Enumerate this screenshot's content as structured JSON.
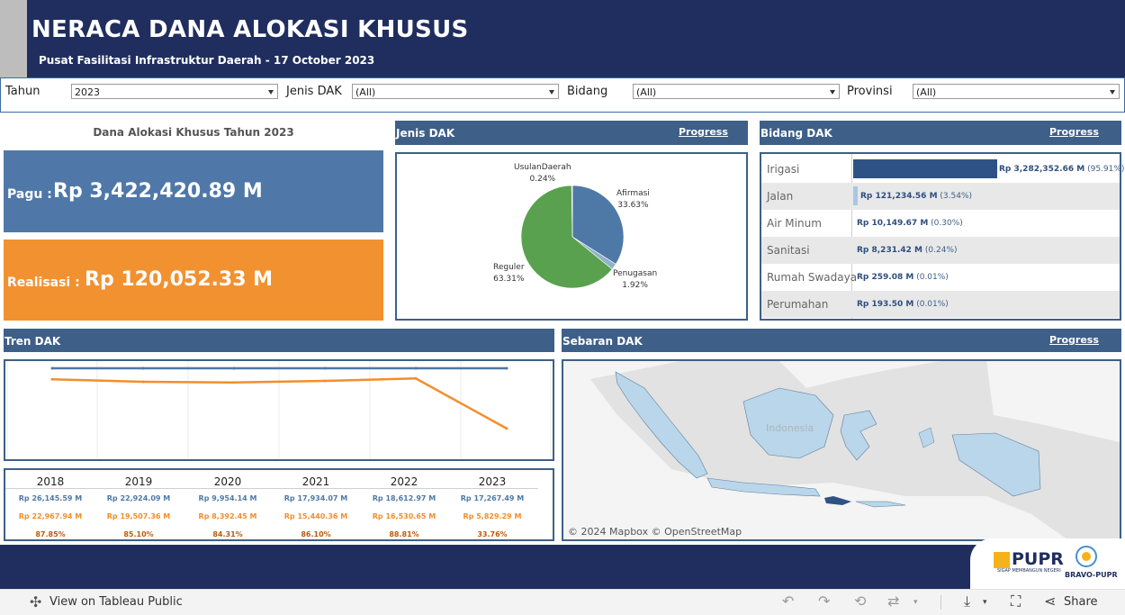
{
  "header": {
    "title": "NERACA DANA ALOKASI KHUSUS",
    "subtitle": "Pusat Fasilitasi Infrastruktur Daerah - 17 October 2023"
  },
  "filters": [
    {
      "label": "Tahun",
      "value": "2023"
    },
    {
      "label": "Jenis DAK",
      "value": "(All)"
    },
    {
      "label": "Bidang",
      "value": "(All)"
    },
    {
      "label": "Provinsi",
      "value": "(All)"
    }
  ],
  "summary": {
    "title": "Dana Alokasi Khusus Tahun 2023",
    "pagu_label": "Pagu :",
    "pagu_value": "Rp 3,422,420.89 M",
    "realisasi_label": "Realisasi :",
    "realisasi_value": "Rp 120,052.33 M",
    "pagu_color": "#4f78a8",
    "realisasi_color": "#f29130"
  },
  "jenis_dak": {
    "title": "Jenis DAK",
    "link": "Progress",
    "slices": [
      {
        "name": "Afirmasi",
        "pct": "33.63%",
        "value": 33.63,
        "color": "#4e79a7"
      },
      {
        "name": "Penugasan",
        "pct": "1.92%",
        "value": 1.92,
        "color": "#8fb4c6"
      },
      {
        "name": "Reguler",
        "pct": "63.31%",
        "value": 63.31,
        "color": "#59a14f"
      },
      {
        "name": "UsulanDaerah",
        "pct": "0.24%",
        "value": 0.24,
        "color": "#e1c04a"
      }
    ]
  },
  "bidang_dak": {
    "title": "Bidang DAK",
    "link": "Progress",
    "rows": [
      {
        "name": "Irigasi",
        "amount": "Rp 3,282,352.66 M",
        "pct": "(95.91%)",
        "value": 95.91
      },
      {
        "name": "Jalan",
        "amount": "Rp 121,234.56 M",
        "pct": "(3.54%)",
        "value": 3.54
      },
      {
        "name": "Air Minum",
        "amount": "Rp 10,149.67 M",
        "pct": "(0.30%)",
        "value": 0.3
      },
      {
        "name": "Sanitasi",
        "amount": "Rp 8,231.42 M",
        "pct": "(0.24%)",
        "value": 0.24
      },
      {
        "name": "Rumah Swadaya",
        "amount": "Rp 259.08 M",
        "pct": "(0.01%)",
        "value": 0.01
      },
      {
        "name": "Perumahan",
        "amount": "Rp 193.50 M",
        "pct": "(0.01%)",
        "value": 0.01
      }
    ]
  },
  "tren_dak": {
    "title": "Tren DAK",
    "years": [
      "2018",
      "2019",
      "2020",
      "2021",
      "2022",
      "2023"
    ],
    "pagu": [
      "Rp 26,145.59 M",
      "Rp 22,924.09 M",
      "Rp 9,954.14 M",
      "Rp 17,934.07 M",
      "Rp 18,612.97 M",
      "Rp 17,267.49 M"
    ],
    "realisasi": [
      "Rp 22,967.94 M",
      "Rp 19,507.36 M",
      "Rp 8,392.45 M",
      "Rp 15,440.36 M",
      "Rp 16,530.65 M",
      "Rp 5,829.29 M"
    ],
    "persen": [
      "87.85%",
      "85.10%",
      "84.31%",
      "86.10%",
      "88.81%",
      "33.76%"
    ]
  },
  "chart_data": {
    "type": "line",
    "x": [
      "2018",
      "2019",
      "2020",
      "2021",
      "2022",
      "2023"
    ],
    "series": [
      {
        "values": [
          100,
          100,
          100,
          100,
          100,
          100
        ],
        "color": "#4e79a7"
      },
      {
        "values": [
          87.85,
          85.1,
          84.31,
          86.1,
          88.81,
          33.76
        ],
        "color": "#f28e2b"
      }
    ],
    "ylim": [
      0,
      100
    ],
    "grid": "vertical"
  },
  "sebaran_dak": {
    "title": "Sebaran DAK",
    "link": "Progress",
    "map_label": "Indonesia",
    "attribution": "© 2024 Mapbox  © OpenStreetMap"
  },
  "logos": {
    "pupr": "PUPR",
    "pupr_tagline": "SIGAP MEMBANGUN NEGERI",
    "bravo": "BRAVO-PUPR"
  },
  "toolbar": {
    "view_label": "View on Tableau Public",
    "share_label": "Share"
  }
}
